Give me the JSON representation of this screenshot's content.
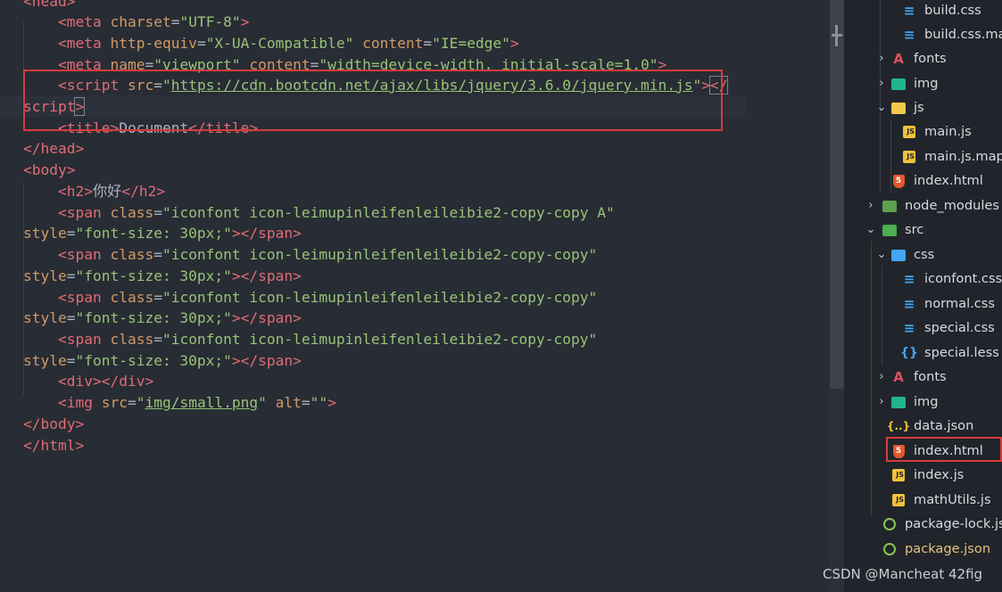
{
  "editor": {
    "lines": [
      [
        [
          "tg",
          "<"
        ],
        [
          "tg",
          "head"
        ],
        [
          "tg",
          ">"
        ]
      ],
      [
        [
          "pu",
          "    "
        ],
        [
          "tg",
          "<meta"
        ],
        [
          "pu",
          " "
        ],
        [
          "at",
          "charset"
        ],
        [
          "pu",
          "="
        ],
        [
          "st",
          "\"UTF-8\""
        ],
        [
          "tg",
          ">"
        ]
      ],
      [
        [
          "pu",
          "    "
        ],
        [
          "tg",
          "<meta"
        ],
        [
          "pu",
          " "
        ],
        [
          "at",
          "http-equiv"
        ],
        [
          "pu",
          "="
        ],
        [
          "st",
          "\"X-UA-Compatible\""
        ],
        [
          "pu",
          " "
        ],
        [
          "at",
          "content"
        ],
        [
          "pu",
          "="
        ],
        [
          "st",
          "\"IE=edge\""
        ],
        [
          "tg",
          ">"
        ]
      ],
      [
        [
          "pu",
          "    "
        ],
        [
          "tg",
          "<meta"
        ],
        [
          "pu",
          " "
        ],
        [
          "at",
          "name"
        ],
        [
          "pu",
          "="
        ],
        [
          "st",
          "\"viewport\""
        ],
        [
          "pu",
          " "
        ],
        [
          "at",
          "content"
        ],
        [
          "pu",
          "="
        ],
        [
          "st",
          "\"width=device-width, initial-scale=1.0\""
        ],
        [
          "tg",
          ">"
        ]
      ],
      [
        [
          "pu",
          "    "
        ],
        [
          "tg",
          "<script"
        ],
        [
          "pu",
          " "
        ],
        [
          "at",
          "src"
        ],
        [
          "pu",
          "="
        ],
        [
          "st",
          "\""
        ],
        [
          "stl",
          "https://cdn.bootcdn.net/ajax/libs/jquery/3.6.0/jquery.min.js"
        ],
        [
          "st",
          "\""
        ],
        [
          "tg",
          ">"
        ],
        [
          "tgb",
          "</"
        ]
      ],
      [
        [
          "tg",
          "script"
        ],
        [
          "tgb",
          ">"
        ]
      ],
      [
        [
          "pu",
          "    "
        ],
        [
          "tg",
          "<title>"
        ],
        [
          "tx",
          "Document"
        ],
        [
          "tg",
          "</title>"
        ]
      ],
      [
        [
          "tg",
          "</head>"
        ]
      ],
      [
        [
          "tg",
          "<body>"
        ]
      ],
      [
        [
          "pu",
          "    "
        ],
        [
          "tg",
          "<h2>"
        ],
        [
          "tx",
          "你好"
        ],
        [
          "tg",
          "</h2>"
        ]
      ],
      [
        [
          "pu",
          "    "
        ],
        [
          "tg",
          "<span"
        ],
        [
          "pu",
          " "
        ],
        [
          "at",
          "class"
        ],
        [
          "pu",
          "="
        ],
        [
          "st",
          "\"iconfont icon-leimupinleifenleileibie2-copy-copy A\""
        ]
      ],
      [
        [
          "at",
          "style"
        ],
        [
          "pu",
          "="
        ],
        [
          "st",
          "\"font-size: 30px;\""
        ],
        [
          "tg",
          "></span>"
        ]
      ],
      [
        [
          "pu",
          "    "
        ],
        [
          "tg",
          "<span"
        ],
        [
          "pu",
          " "
        ],
        [
          "at",
          "class"
        ],
        [
          "pu",
          "="
        ],
        [
          "st",
          "\"iconfont icon-leimupinleifenleileibie2-copy-copy\""
        ]
      ],
      [
        [
          "at",
          "style"
        ],
        [
          "pu",
          "="
        ],
        [
          "st",
          "\"font-size: 30px;\""
        ],
        [
          "tg",
          "></span>"
        ]
      ],
      [
        [
          "pu",
          "    "
        ],
        [
          "tg",
          "<span"
        ],
        [
          "pu",
          " "
        ],
        [
          "at",
          "class"
        ],
        [
          "pu",
          "="
        ],
        [
          "st",
          "\"iconfont icon-leimupinleifenleileibie2-copy-copy\""
        ]
      ],
      [
        [
          "at",
          "style"
        ],
        [
          "pu",
          "="
        ],
        [
          "st",
          "\"font-size: 30px;\""
        ],
        [
          "tg",
          "></span>"
        ]
      ],
      [
        [
          "pu",
          "    "
        ],
        [
          "tg",
          "<span"
        ],
        [
          "pu",
          " "
        ],
        [
          "at",
          "class"
        ],
        [
          "pu",
          "="
        ],
        [
          "st",
          "\"iconfont icon-leimupinleifenleileibie2-copy-copy\""
        ]
      ],
      [
        [
          "at",
          "style"
        ],
        [
          "pu",
          "="
        ],
        [
          "st",
          "\"font-size: 30px;\""
        ],
        [
          "tg",
          "></span>"
        ]
      ],
      [
        [
          "pu",
          "    "
        ],
        [
          "tg",
          "<div></div>"
        ]
      ],
      [
        [
          "pu",
          "    "
        ],
        [
          "tg",
          "<img"
        ],
        [
          "pu",
          " "
        ],
        [
          "at",
          "src"
        ],
        [
          "pu",
          "="
        ],
        [
          "st",
          "\""
        ],
        [
          "stl",
          "img/small.png"
        ],
        [
          "st",
          "\""
        ],
        [
          "pu",
          " "
        ],
        [
          "at",
          "alt"
        ],
        [
          "pu",
          "="
        ],
        [
          "st",
          "\"\""
        ],
        [
          "tg",
          ">"
        ]
      ],
      [
        [
          "tg",
          "</body>"
        ]
      ],
      [
        [
          "tg",
          "</html>"
        ]
      ]
    ]
  },
  "explorer": {
    "items": [
      {
        "label": "build.css",
        "icon": "css-file-icon",
        "chev": ""
      },
      {
        "label": "build.css.map",
        "icon": "css-map-file-icon",
        "chev": ""
      },
      {
        "label": "fonts",
        "icon": "font-folder-icon",
        "chev": "›"
      },
      {
        "label": "img",
        "icon": "image-folder-icon",
        "chev": "›"
      },
      {
        "label": "js",
        "icon": "js-folder-open-icon",
        "chev": "⌄"
      },
      {
        "label": "main.js",
        "icon": "js-file-icon",
        "chev": ""
      },
      {
        "label": "main.js.map",
        "icon": "js-map-file-icon",
        "chev": ""
      },
      {
        "label": "index.html",
        "icon": "html-file-icon",
        "chev": ""
      },
      {
        "label": "node_modules",
        "icon": "node-modules-folder-icon",
        "chev": "›"
      },
      {
        "label": "src",
        "icon": "src-folder-icon",
        "chev": "⌄"
      },
      {
        "label": "css",
        "icon": "css-folder-open-icon",
        "chev": "⌄"
      },
      {
        "label": "iconfont.css",
        "icon": "css-file-icon",
        "chev": ""
      },
      {
        "label": "normal.css",
        "icon": "css-file-icon",
        "chev": ""
      },
      {
        "label": "special.css",
        "icon": "css-file-icon",
        "chev": ""
      },
      {
        "label": "special.less",
        "icon": "less-file-icon",
        "chev": ""
      },
      {
        "label": "fonts",
        "icon": "font-folder-icon",
        "chev": "›"
      },
      {
        "label": "img",
        "icon": "image-folder-icon",
        "chev": "›"
      },
      {
        "label": "data.json",
        "icon": "json-file-icon",
        "chev": ""
      },
      {
        "label": "index.html",
        "icon": "html-file-icon",
        "chev": ""
      },
      {
        "label": "index.js",
        "icon": "js-file-icon",
        "chev": ""
      },
      {
        "label": "mathUtils.js",
        "icon": "js-file-icon",
        "chev": ""
      },
      {
        "label": "package-lock.json",
        "icon": "package-lock-icon",
        "chev": ""
      },
      {
        "label": "package.json",
        "icon": "package-json-icon",
        "chev": ""
      }
    ]
  },
  "watermark": "CSDN @Mancheat 42fig",
  "colors": {
    "tag": "#e06c75",
    "attribute": "#d19a66",
    "string": "#98c379",
    "text": "#abb2bf",
    "highlight_border": "#d63b3b",
    "editor_bg": "#282c34",
    "sidebar_bg": "#21252b"
  }
}
